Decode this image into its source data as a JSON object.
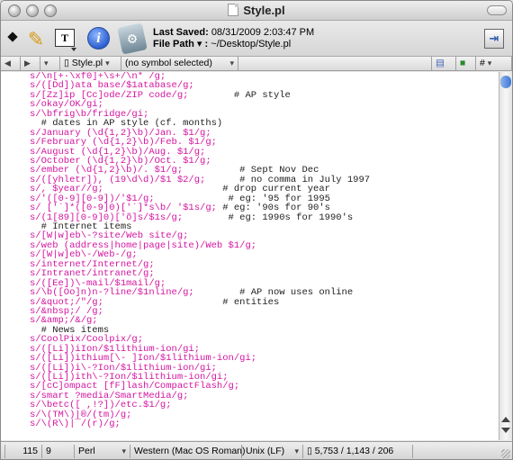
{
  "window": {
    "title": "Style.pl"
  },
  "toolbar": {
    "last_saved_label": "Last Saved:",
    "last_saved_value": "08/31/2009 2:03:47 PM",
    "file_path_label": "File Path ▾ :",
    "file_path_value": "~/Desktop/Style.pl"
  },
  "navbar": {
    "file_name": "Style.pl",
    "symbol": "(no symbol selected)"
  },
  "code": {
    "lines": [
      {
        "code": "s/\\n[+·\\xf0]+\\s+/\\n* /g;",
        "comment": ""
      },
      {
        "code": "s/([Dd])ata base/$1atabase/g;",
        "comment": ""
      },
      {
        "code": "s/[Zz]ip [Cc]ode/ZIP code/g;",
        "comment": "        # AP style"
      },
      {
        "code": "s/okay/OK/gi;",
        "comment": ""
      },
      {
        "code": "s/\\bfrig\\b/fridge/gi;",
        "comment": ""
      },
      {
        "code": "",
        "comment": "  # dates in AP style (cf. months)"
      },
      {
        "code": "s/January (\\d{1,2}\\b)/Jan. $1/g;",
        "comment": ""
      },
      {
        "code": "s/February (\\d{1,2}\\b)/Feb. $1/g;",
        "comment": ""
      },
      {
        "code": "s/August (\\d{1,2}\\b)/Aug. $1/g;",
        "comment": ""
      },
      {
        "code": "s/October (\\d{1,2}\\b)/Oct. $1/g;",
        "comment": ""
      },
      {
        "code": "s/ember (\\d{1,2}\\b)/. $1/g;",
        "comment": "          # Sept Nov Dec"
      },
      {
        "code": "s/([yhletr]), (19\\d\\d)/$1 $2/g;",
        "comment": "      # no comma in July 1997"
      },
      {
        "code": "s/, $year//g;",
        "comment": "                     # drop current year"
      },
      {
        "code": "s/'([0-9][0-9])/'$1/g;",
        "comment": "             # eg: '95 for 1995"
      },
      {
        "code": "s/ ['`]*([0-9]0)['`]*s\\b/ '$1s/g;",
        "comment": " # eg: '90s for 90's"
      },
      {
        "code": "s/(1[89][0-9]0)['õ]s/$1s/g;",
        "comment": "        # eg: 1990s for 1990's"
      },
      {
        "code": "",
        "comment": "  # Internet items"
      },
      {
        "code": "s/[W|w]eb\\-?site/Web site/g;",
        "comment": ""
      },
      {
        "code": "s/web (address|home|page|site)/Web $1/g;",
        "comment": ""
      },
      {
        "code": "s/[W|w]eb\\-/Web-/g;",
        "comment": ""
      },
      {
        "code": "s/internet/Internet/g;",
        "comment": ""
      },
      {
        "code": "s/Intranet/intranet/g;",
        "comment": ""
      },
      {
        "code": "s/([Ee])\\-mail/$1mail/g;",
        "comment": ""
      },
      {
        "code": "s/\\b([Oo]n)n-?line/$1nline/g;",
        "comment": "        # AP now uses online"
      },
      {
        "code": "s/&quot;/\"/g;",
        "comment": "                     # entities"
      },
      {
        "code": "s/&nbsp;/ /g;",
        "comment": ""
      },
      {
        "code": "s/&amp;/&/g;",
        "comment": ""
      },
      {
        "code": "",
        "comment": "  # News items"
      },
      {
        "code": "s/CoolPix/Coolpix/g;",
        "comment": ""
      },
      {
        "code": "s/([Li])iIon/$1lithium-ion/gi;",
        "comment": ""
      },
      {
        "code": "s/([Li])ithium[\\- ]Ion/$1lithium-ion/gi;",
        "comment": ""
      },
      {
        "code": "s/([Li])i\\-?Ion/$1lithium-ion/gi;",
        "comment": ""
      },
      {
        "code": "s/([Li])ith\\-?Ion/$1lithium-ion/gi;",
        "comment": ""
      },
      {
        "code": "s/[cC]ompact [fF]lash/CompactFlash/g;",
        "comment": ""
      },
      {
        "code": "s/smart ?media/SmartMedia/g;",
        "comment": ""
      },
      {
        "code": "s/\\betc([ ,!?])/etc.$1/g;",
        "comment": ""
      },
      {
        "code": "s/\\(TM\\)|®/(tm)/g;",
        "comment": ""
      },
      {
        "code": "s/\\(R\\)|¯/(r)/g;",
        "comment": ""
      }
    ]
  },
  "status": {
    "line": "115",
    "column": "9",
    "language": "Perl",
    "encoding": "Western (Mac OS Roman)",
    "line_endings": "Unix (LF)",
    "doc_stats": "5,753 / 1,143 / 206"
  },
  "colors": {
    "regex": "#d4149f",
    "comment": "#222222"
  },
  "icons": [
    "diamond-icon",
    "pencil-icon",
    "text-options-icon",
    "info-icon",
    "wrench-icon",
    "document-icon",
    "split-window-icon"
  ]
}
